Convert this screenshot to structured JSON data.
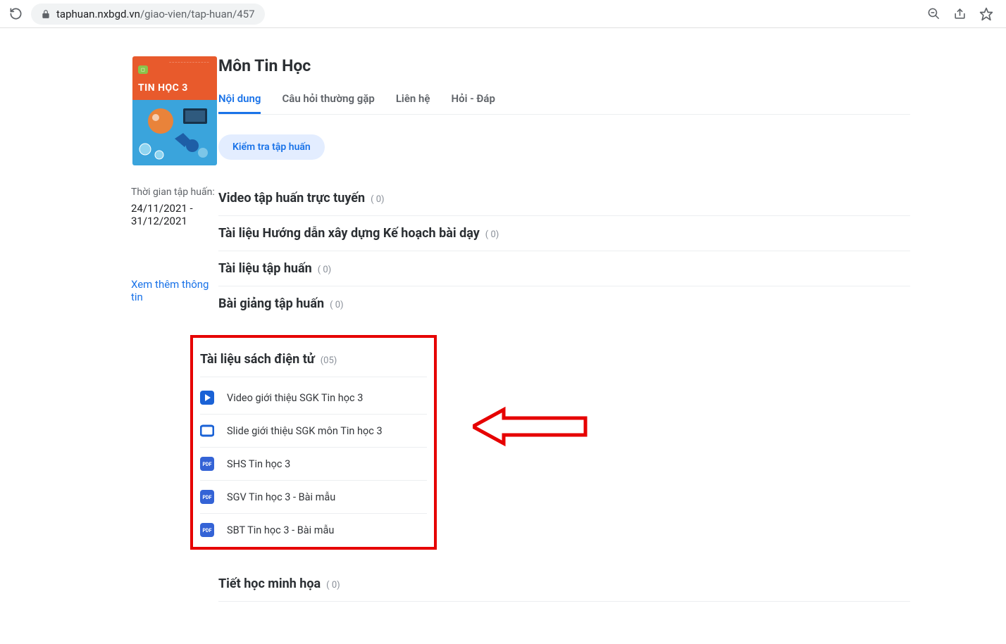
{
  "browser": {
    "url_domain": "taphuan.nxbgd.vn",
    "url_path": "/giao-vien/tap-huan/457"
  },
  "sidebar": {
    "book_title": "TIN HỌC  3",
    "time_label": "Thời gian tập huấn:",
    "time_value": "24/11/2021 - 31/12/2021",
    "more_link": "Xem thêm thông tin"
  },
  "page": {
    "title": "Môn Tin Học",
    "check_button": "Kiểm tra tập huấn"
  },
  "tabs": [
    {
      "label": "Nội dung",
      "active": true
    },
    {
      "label": "Câu hỏi thường gặp",
      "active": false
    },
    {
      "label": "Liên hệ",
      "active": false
    },
    {
      "label": "Hỏi - Đáp",
      "active": false
    }
  ],
  "sections": [
    {
      "title": "Video tập huấn trực tuyến",
      "count": "( 0)"
    },
    {
      "title": "Tài liệu Hướng dẫn xây dựng Kế hoạch bài dạy",
      "count": "( 0)"
    },
    {
      "title": "Tài liệu tập huấn",
      "count": "( 0)"
    },
    {
      "title": "Bài giảng tập huấn",
      "count": "( 0)"
    }
  ],
  "ebook": {
    "title": "Tài liệu sách điện tử",
    "count": "(05)",
    "items": [
      {
        "icon": "play",
        "label": "Video giới thiệu SGK Tin học 3"
      },
      {
        "icon": "slide",
        "label": "Slide giới thiệu SGK môn Tin học 3"
      },
      {
        "icon": "pdf",
        "label": "SHS Tin học 3"
      },
      {
        "icon": "pdf",
        "label": "SGV Tin học 3 - Bài mẫu"
      },
      {
        "icon": "pdf",
        "label": "SBT Tin học 3 - Bài mẫu"
      }
    ]
  },
  "last_section": {
    "title": "Tiết học minh họa",
    "count": "( 0)"
  }
}
